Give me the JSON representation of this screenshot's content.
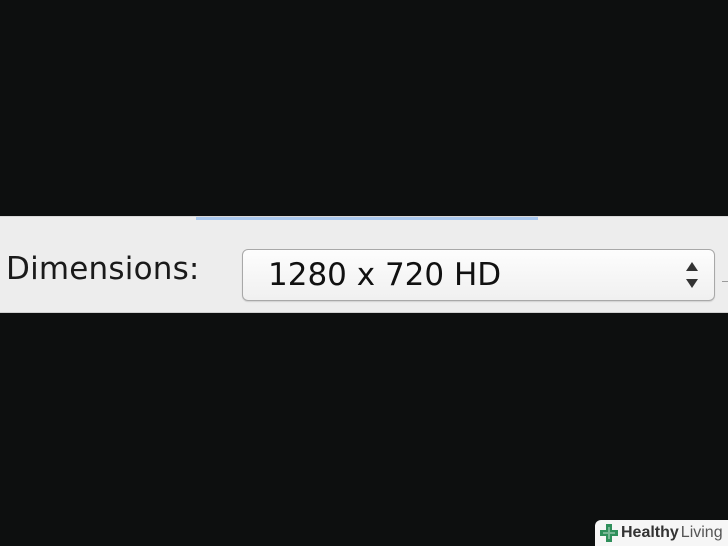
{
  "export_panel": {
    "dimensions_label": "Dimensions:",
    "dimensions_value": "1280 x 720 HD"
  },
  "watermark": {
    "brand_bold": "Healthy",
    "brand_light": "Living",
    "logo_icon": "plus-cross-icon",
    "logo_color": "#2f8f5b"
  },
  "colors": {
    "background": "#0d0f0f",
    "panel": "#ededed",
    "focus_ring": "#a9c8ee"
  }
}
